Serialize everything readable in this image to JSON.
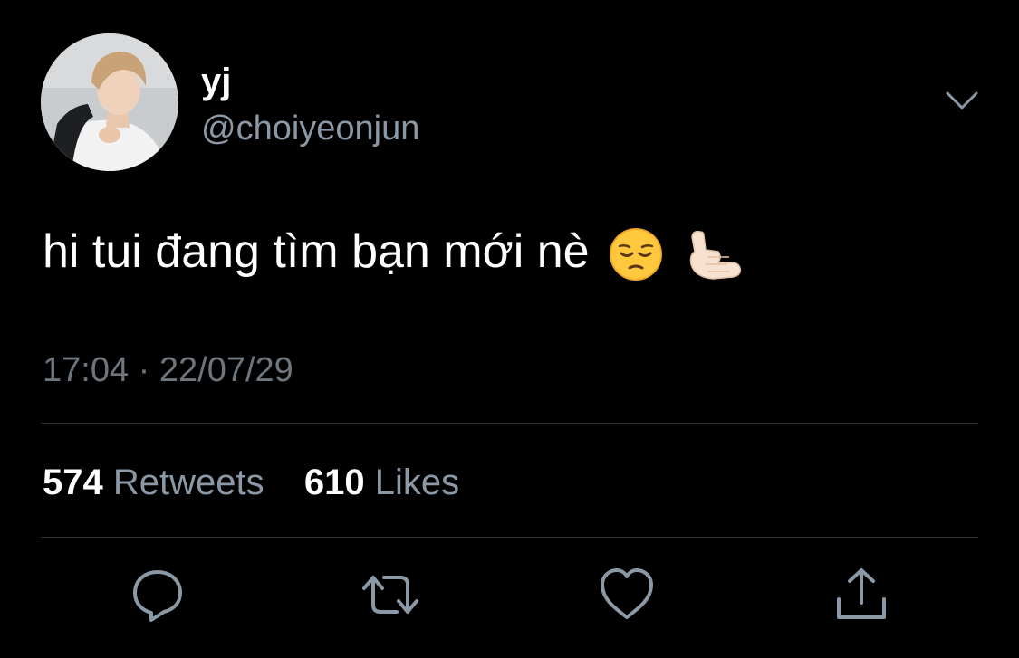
{
  "author": {
    "display_name": "yj",
    "handle": "@choiyeonjun"
  },
  "tweet": {
    "text": "hi tui đang tìm bạn mới nè",
    "emojis": [
      "pensive-face-emoji",
      "call-me-hand-emoji"
    ],
    "time": "17:04",
    "separator": "·",
    "date": "22/07/29"
  },
  "stats": {
    "retweets_count": "574",
    "retweets_label": "Retweets",
    "likes_count": "610",
    "likes_label": "Likes"
  },
  "actions": {
    "reply_icon": "reply-icon",
    "retweet_icon": "retweet-icon",
    "like_icon": "heart-icon",
    "share_icon": "share-icon"
  },
  "colors": {
    "background": "#000000",
    "primary_text": "#ffffff",
    "secondary_text": "#8b98a5",
    "divider": "#2f3336",
    "icon": "#8b98a5"
  }
}
